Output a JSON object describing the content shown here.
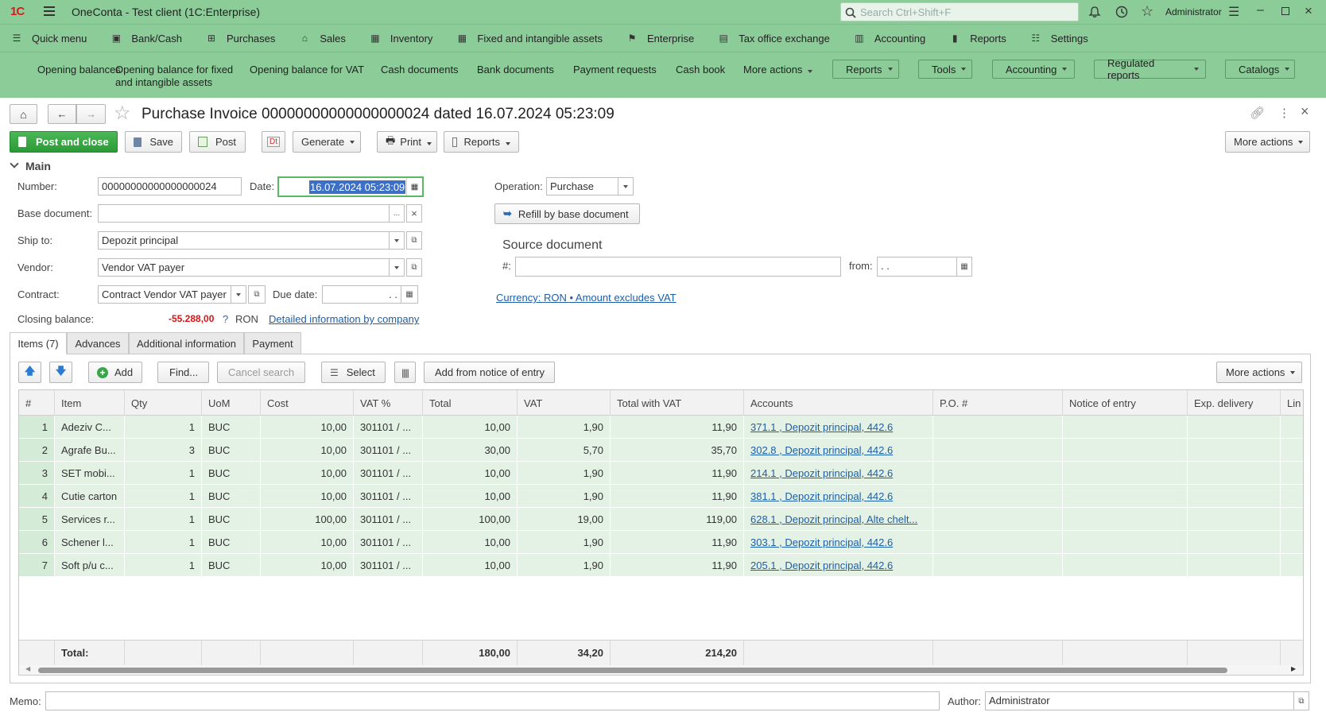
{
  "app": {
    "brand": "1С",
    "title": "OneConta  - Test client (1C:Enterprise)",
    "search_placeholder": "Search Ctrl+Shift+F",
    "user": "Administrator"
  },
  "menu": [
    "Quick menu",
    "Bank/Cash",
    "Purchases",
    "Sales",
    "Inventory",
    "Fixed and intangible assets",
    "Enterprise",
    "Tax office exchange",
    "Accounting",
    "Reports",
    "Settings"
  ],
  "commands": {
    "links": [
      "Opening balances",
      "Opening balance for fixed",
      "and intangible assets",
      "Opening balance for VAT",
      "Cash documents",
      "Bank documents",
      "Payment requests",
      "Cash book",
      "More actions"
    ],
    "buttons": [
      "Reports",
      "Tools",
      "Accounting",
      "Regulated reports",
      "Catalogs"
    ]
  },
  "doc": {
    "title": "Purchase Invoice 00000000000000000024 dated 16.07.2024 05:23:09",
    "toolbar": {
      "post_close": "Post and close",
      "save": "Save",
      "post": "Post",
      "generate": "Generate",
      "print": "Print",
      "reports": "Reports",
      "more": "More actions"
    },
    "section": "Main",
    "labels": {
      "number": "Number:",
      "date": "Date:",
      "base_doc": "Base document:",
      "ship_to": "Ship to:",
      "vendor": "Vendor:",
      "contract": "Contract:",
      "due_date": "Due date:",
      "closing": "Closing balance:",
      "operation": "Operation:",
      "source_doc": "Source document",
      "src_num": "#:",
      "from": "from:"
    },
    "values": {
      "number": "00000000000000000024",
      "date": "16.07.2024 05:23:09",
      "base_doc": "",
      "ship_to": "Depozit principal",
      "vendor": "Vendor VAT payer",
      "contract": "Contract Vendor VAT payer",
      "due_date": "  .  .",
      "closing_amount": "-55.288,00",
      "closing_q": "?",
      "closing_cur": "RON",
      "detail_link": "Detailed information by company",
      "operation": "Purchase",
      "refill": "Refill by base document",
      "src_num": "",
      "src_from": "  .  .",
      "currency_link": "Currency: RON • Amount excludes VAT"
    },
    "tabs": [
      "Items (7)",
      "Advances",
      "Additional information",
      "Payment"
    ],
    "grid_toolbar": {
      "add": "Add",
      "find": "Find...",
      "cancel_search": "Cancel search",
      "select": "Select",
      "add_notice": "Add from notice of entry",
      "more": "More actions"
    },
    "columns": [
      "#",
      "Item",
      "Qty",
      "UoM",
      "Cost",
      "VAT %",
      "Total",
      "VAT",
      "Total with VAT",
      "Accounts",
      "P.O. #",
      "Notice of entry",
      "Exp. delivery",
      "Lin"
    ],
    "rows": [
      [
        "1",
        "Adeziv C...",
        "1",
        "BUC",
        "10,00",
        "301101 / ...",
        "10,00",
        "1,90",
        "11,90",
        "371.1 , Depozit principal, 442.6"
      ],
      [
        "2",
        "Agrafe Bu...",
        "3",
        "BUC",
        "10,00",
        "301101 / ...",
        "30,00",
        "5,70",
        "35,70",
        "302.8 , Depozit principal, 442.6"
      ],
      [
        "3",
        "SET mobi...",
        "1",
        "BUC",
        "10,00",
        "301101 / ...",
        "10,00",
        "1,90",
        "11,90",
        "214.1 , Depozit principal, 442.6"
      ],
      [
        "4",
        "Cutie carton",
        "1",
        "BUC",
        "10,00",
        "301101 / ...",
        "10,00",
        "1,90",
        "11,90",
        "381.1 , Depozit principal, 442.6"
      ],
      [
        "5",
        "Services r...",
        "1",
        "BUC",
        "100,00",
        "301101 / ...",
        "100,00",
        "19,00",
        "119,00",
        "628.1 , Depozit principal, Alte chelt..."
      ],
      [
        "6",
        "Schener l...",
        "1",
        "BUC",
        "10,00",
        "301101 / ...",
        "10,00",
        "1,90",
        "11,90",
        "303.1 , Depozit principal, 442.6"
      ],
      [
        "7",
        "Soft p/u c...",
        "1",
        "BUC",
        "10,00",
        "301101 / ...",
        "10,00",
        "1,90",
        "11,90",
        "205.1 , Depozit principal, 442.6"
      ]
    ],
    "totals": {
      "label": "Total:",
      "total": "180,00",
      "vat": "34,20",
      "total_vat": "214,20"
    },
    "memo_label": "Memo:",
    "memo": "",
    "author_label": "Author:",
    "author": "Administrator"
  }
}
